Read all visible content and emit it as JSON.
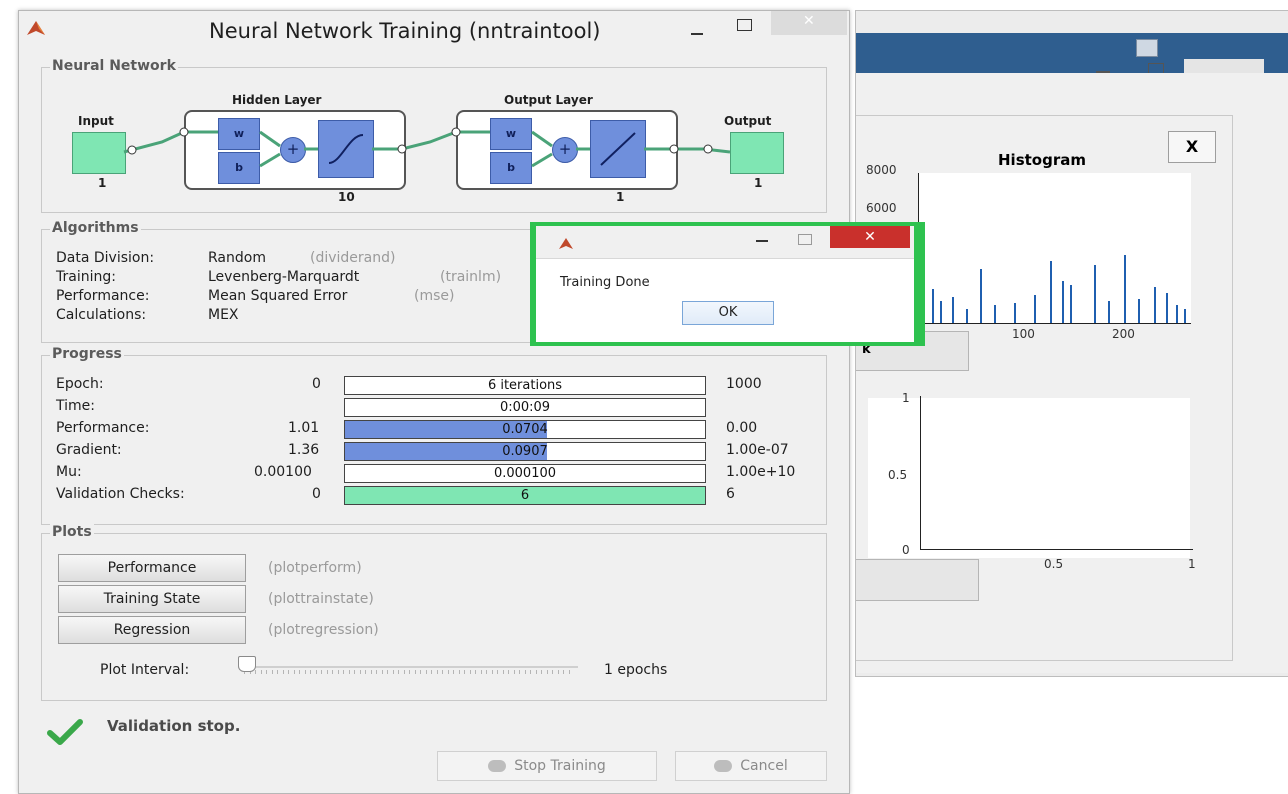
{
  "main_window": {
    "title": "Neural Network Training (nntraintool)",
    "controls": {
      "minimize": "–",
      "maximize": "☐",
      "close": "✕"
    }
  },
  "network": {
    "group_title": "Neural Network",
    "input_label": "Input",
    "input_size": "1",
    "hidden_label": "Hidden Layer",
    "hidden_size": "10",
    "output_layer_label": "Output Layer",
    "output_layer_size": "1",
    "output_label": "Output",
    "output_size": "1",
    "w_label": "w",
    "b_label": "b",
    "plus_symbol": "+"
  },
  "algorithms": {
    "group_title": "Algorithms",
    "rows": [
      {
        "label": "Data Division:",
        "value": "Random",
        "code": "(dividerand)"
      },
      {
        "label": "Training:",
        "value": "Levenberg-Marquardt",
        "code": "(trainlm)"
      },
      {
        "label": "Performance:",
        "value": "Mean Squared Error",
        "code": "(mse)"
      },
      {
        "label": "Calculations:",
        "value": "MEX",
        "code": ""
      }
    ]
  },
  "progress": {
    "group_title": "Progress",
    "rows": [
      {
        "label": "Epoch:",
        "start": "0",
        "current": "6 iterations",
        "end": "1000",
        "fill": 0
      },
      {
        "label": "Time:",
        "start": "",
        "current": "0:00:09",
        "end": "",
        "fill": 0
      },
      {
        "label": "Performance:",
        "start": "1.01",
        "current": "0.0704",
        "end": "0.00",
        "fill": 0.56
      },
      {
        "label": "Gradient:",
        "start": "1.36",
        "current": "0.0907",
        "end": "1.00e-07",
        "fill": 0.56
      },
      {
        "label": "Mu:",
        "start": "0.00100",
        "current": "0.000100",
        "end": "1.00e+10",
        "fill": 0
      },
      {
        "label": "Validation Checks:",
        "start": "0",
        "current": "6",
        "end": "6",
        "fill": 1.0
      }
    ],
    "colors": {
      "blue_fill": "#6f8fdc",
      "green_fill": "#7fe6b3"
    }
  },
  "plots": {
    "group_title": "Plots",
    "buttons": [
      {
        "label": "Performance",
        "fn": "(plotperform)"
      },
      {
        "label": "Training State",
        "fn": "(plottrainstate)"
      },
      {
        "label": "Regression",
        "fn": "(plotregression)"
      }
    ],
    "interval_label": "Plot Interval:",
    "interval_value": "1 epochs"
  },
  "status": {
    "text": "Validation stop."
  },
  "footer": {
    "stop_label": "Stop Training",
    "cancel_label": "Cancel"
  },
  "dialog": {
    "message": "Training Done",
    "ok_label": "OK",
    "border_color": "#2ec24f",
    "close_color": "#c9302c"
  },
  "background_window": {
    "close_x": "X",
    "histogram": {
      "title": "Histogram",
      "y_ticks": [
        "8000",
        "6000"
      ],
      "x_ticks": [
        "100",
        "200"
      ],
      "button_partial": "k"
    },
    "second_plot": {
      "y_ticks": [
        "1",
        "0.5",
        "0"
      ],
      "x_ticks": [
        "0.5",
        "1"
      ]
    }
  }
}
